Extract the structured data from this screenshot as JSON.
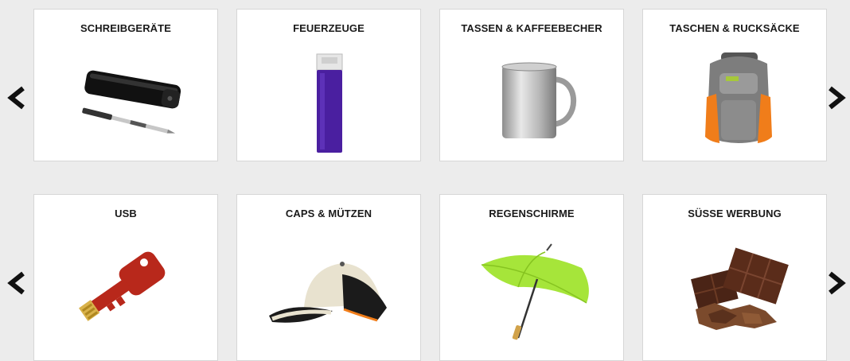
{
  "carousel_rows": [
    {
      "items": [
        {
          "label": "SCHREIBGERÄTE",
          "icon": "pen-case-icon"
        },
        {
          "label": "FEUERZEUGE",
          "icon": "lighter-icon"
        },
        {
          "label": "TASSEN & KAFFEEBECHER",
          "icon": "mug-icon"
        },
        {
          "label": "TASCHEN & RUCKSÄCKE",
          "icon": "backpack-icon"
        }
      ]
    },
    {
      "items": [
        {
          "label": "USB",
          "icon": "usb-key-icon"
        },
        {
          "label": "CAPS & MÜTZEN",
          "icon": "cap-icon"
        },
        {
          "label": "REGENSCHIRME",
          "icon": "umbrella-icon"
        },
        {
          "label": "SÜSSE WERBUNG",
          "icon": "chocolate-icon"
        }
      ]
    }
  ],
  "navigation": {
    "prev_icon": "chevron-left-icon",
    "next_icon": "chevron-right-icon"
  },
  "colors": {
    "background": "#ececec",
    "card_background": "#ffffff",
    "card_border": "#d6d6d6",
    "title_text": "#1a1a1a",
    "lighter_purple": "#4a1fa0",
    "backpack_orange": "#f07d1a",
    "usb_red": "#b8281b",
    "umbrella_green": "#a6e53a",
    "chocolate_brown": "#4a2416"
  }
}
